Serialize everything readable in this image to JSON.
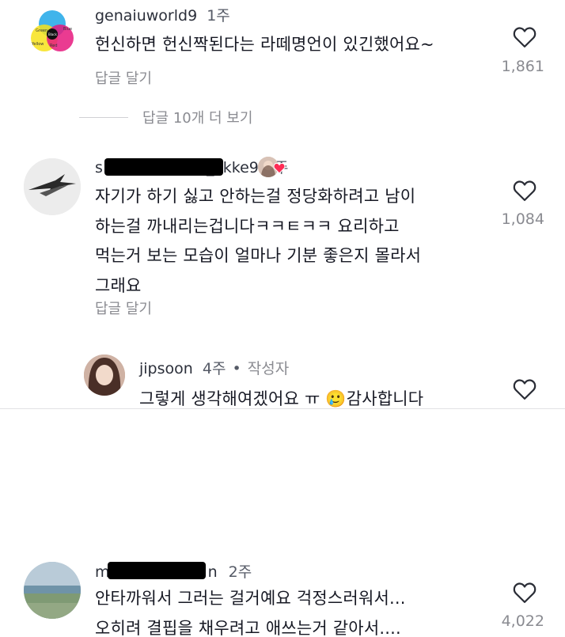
{
  "comments": [
    {
      "username": "genaiuworld9",
      "time": "1주",
      "text_lines": [
        "헌신하면 헌신짝된다는 라떼명언이 있긴했어요~"
      ],
      "reply_label": "답글 달기",
      "likes": "1,861"
    },
    {
      "username_prefix": "s",
      "username_suffix": "ack_xkke9",
      "time": "4주",
      "text_lines": [
        "자기가 하기 싫고 안하는걸 정당화하려고 남이",
        "하는걸 까내리는겁니다ㅋㅋㅌㅋㅋ 요리하고",
        "먹는거 보는 모습이 얼마나 기분 좋은지 몰라서",
        "그래요"
      ],
      "reply_label": "답글 달기",
      "likes": "1,084"
    },
    {
      "username": "jipsoon",
      "time": "4주",
      "dot": "•",
      "author_label": "작성자",
      "text_lines": [
        "그렇게 생각해여겠어요 ㅠ 🥲감사합니다"
      ]
    },
    {
      "username_prefix": "m",
      "username_suffix": "n",
      "time": "2주",
      "text_lines": [
        "안타까워서 그러는 걸거예요 걱정스러워서...",
        "오히려 결핍을 채우려고 애쓰는거 같아서...."
      ],
      "likes": "4,022"
    }
  ],
  "more_replies_label": "답글 10개 더 보기",
  "avatar1_labels": [
    "Green",
    "Blue",
    "Black",
    "Yellow",
    "Red"
  ],
  "icons": {
    "like": "heart-outline-icon",
    "liked_badge": "heart-icon"
  },
  "colors": {
    "heart_badge": "#fe2c55",
    "muted": "#8a8b91"
  }
}
